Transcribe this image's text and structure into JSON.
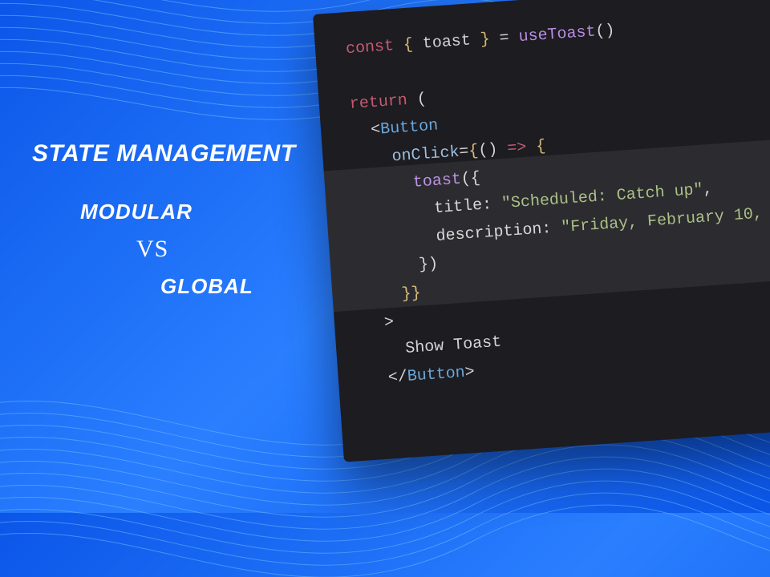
{
  "headline": {
    "title": "STATE MANAGEMENT",
    "modular": "MODULAR",
    "vs": "VS",
    "global": "GLOBAL"
  },
  "code": {
    "l1": {
      "kw": "const",
      "brace1": " { ",
      "var": "toast",
      "brace2": " } ",
      "eq": "= ",
      "fn": "useToast",
      "call": "()"
    },
    "l2": {
      "kw": "return",
      "paren": " ("
    },
    "l3": {
      "open": "<",
      "tag": "Button"
    },
    "l4": {
      "attr": "onClick",
      "eq": "=",
      "b1": "{",
      "p1": "() ",
      "arrow": "=>",
      "b2": " {"
    },
    "l5": {
      "fn": "toast",
      "open": "({"
    },
    "l6": {
      "prop": "title",
      "colon": ": ",
      "str": "\"Scheduled: Catch up\"",
      "comma": ","
    },
    "l7": {
      "prop": "description",
      "colon": ": ",
      "str": "\"Friday, February 10,"
    },
    "l8": {
      "close": "})"
    },
    "l9": {
      "close": "}}"
    },
    "l10": {
      "gt": ">"
    },
    "l11": {
      "text": "Show Toast"
    },
    "l12": {
      "open": "</",
      "tag": "Button",
      "gt": ">"
    }
  }
}
